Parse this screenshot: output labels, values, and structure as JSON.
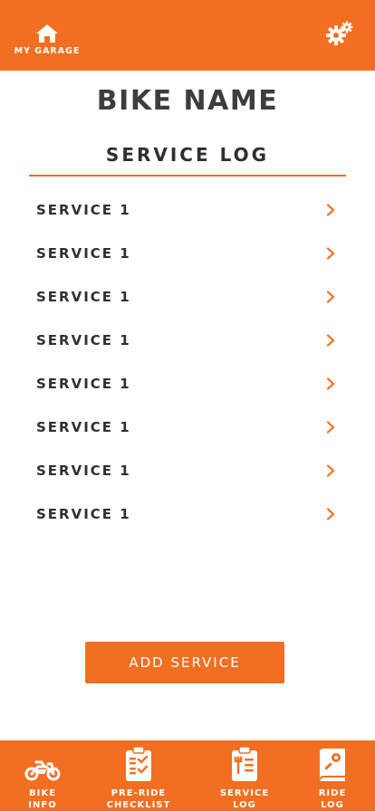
{
  "header": {
    "home_label": "MY GARAGE",
    "home_icon": "home-icon",
    "settings_icon": "gears-icon"
  },
  "main": {
    "bike_name": "BIKE NAME",
    "section_title": "SERVICE LOG",
    "services": [
      {
        "label": "SERVICE 1"
      },
      {
        "label": "SERVICE 1"
      },
      {
        "label": "SERVICE 1"
      },
      {
        "label": "SERVICE 1"
      },
      {
        "label": "SERVICE 1"
      },
      {
        "label": "SERVICE 1"
      },
      {
        "label": "SERVICE 1"
      },
      {
        "label": "SERVICE 1"
      }
    ],
    "add_button_label": "ADD SERVICE"
  },
  "bottom_nav": [
    {
      "line1": "BIKE",
      "line2": "INFO",
      "icon": "motorcycle-icon"
    },
    {
      "line1": "PRE-RIDE",
      "line2": "CHECKLIST",
      "icon": "checklist-icon"
    },
    {
      "line1": "SERVICE",
      "line2": "LOG",
      "icon": "service-clipboard-icon"
    },
    {
      "line1": "RIDE",
      "line2": "LOG",
      "icon": "ride-book-icon"
    }
  ],
  "colors": {
    "accent": "#f26f21",
    "text_dark": "#2f2f2f",
    "background": "#ffffff"
  }
}
